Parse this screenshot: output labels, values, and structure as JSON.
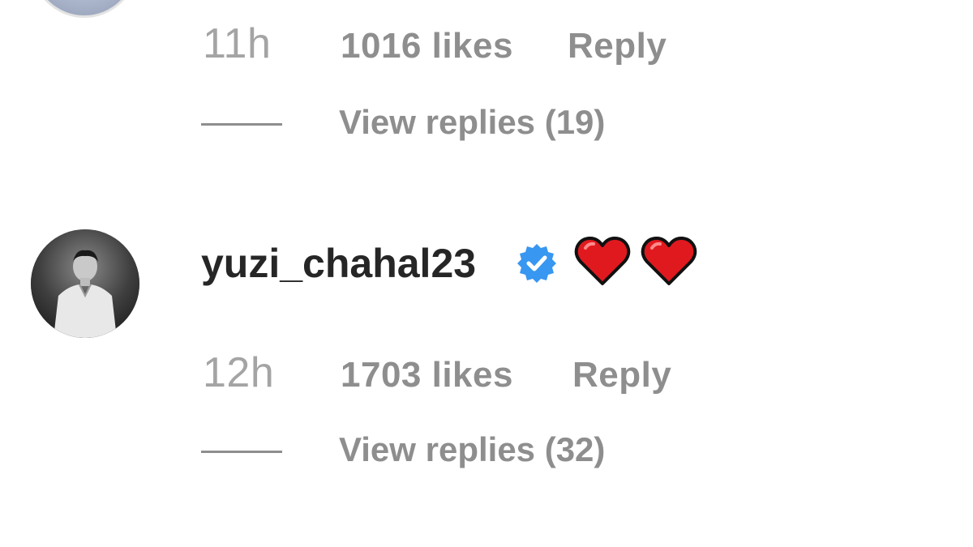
{
  "comments": [
    {
      "time": "11h",
      "likes": "1016 likes",
      "reply_label": "Reply",
      "view_replies": "View replies (19)"
    },
    {
      "username": "yuzi_chahal23",
      "verified": true,
      "text_icons": [
        "red-heart-icon",
        "red-heart-icon"
      ],
      "time": "12h",
      "likes": "1703 likes",
      "reply_label": "Reply",
      "view_replies": "View replies (32)"
    }
  ],
  "colors": {
    "username": "#262626",
    "meta": "#8e8e8e",
    "verified": "#3897f0",
    "heart": "#e0191f"
  }
}
